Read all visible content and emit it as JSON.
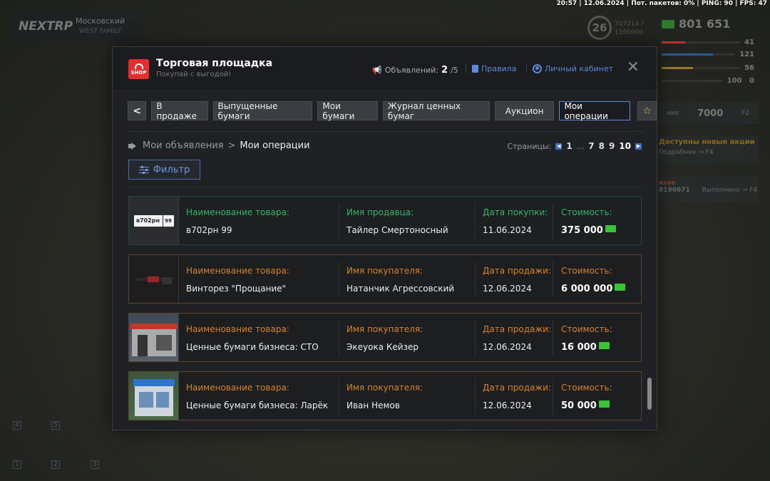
{
  "status_bar": "20:57 | 12.06.2024 | Пот. пакетов: 0% | PING: 90 | FPS: 47",
  "hud": {
    "logo": "NEXTRP",
    "server_name": "Московский",
    "server_sub": "WEST FAMILY",
    "level": "26",
    "exp_current": "707214 /",
    "exp_total": "1160000",
    "money": "801 651",
    "stats": [
      "41",
      "121",
      "56"
    ],
    "stats2": [
      "100",
      "0"
    ],
    "side_money": "7000",
    "side_label": "ние",
    "key_f2": "F2",
    "promo_title": "Доступны новые акции",
    "promo_more": "Подробнее →",
    "key_f4": "F4",
    "task_prefix": "изов",
    "task_id": "8196671",
    "task_status": "Выполнено →",
    "key_f4b": "F4",
    "slots": [
      "4",
      "5",
      "1",
      "2",
      "3"
    ]
  },
  "modal": {
    "shop_label": "SHOP",
    "title": "Торговая площадка",
    "subtitle": "Покупай с выгодой!",
    "ads_label": "Объявлений:",
    "ads_count": "2",
    "ads_limit": "/5",
    "rules_label": "Правила",
    "account_label": "Личный кабинет",
    "close": "✕"
  },
  "tabs": {
    "back": "<",
    "items": [
      "В продаже",
      "Выпущенные бумаги",
      "Мои бумаги",
      "Журнал ценных бумаг",
      "Аукцион",
      "Мои операции"
    ],
    "star": "☆"
  },
  "breadcrumb": {
    "parent": "Мои объявления",
    "sep": ">",
    "current": "Мои операции"
  },
  "pagination": {
    "label": "Страницы:",
    "prev": "◀",
    "next": "▶",
    "pages": [
      "1",
      "...",
      "7",
      "8",
      "9",
      "10"
    ],
    "active": "10"
  },
  "filter_label": "Фильтр",
  "operations": [
    {
      "type": "buy",
      "thumb_plate": "в702рн",
      "thumb_region": "99",
      "name_label": "Наименование товара:",
      "name": "в702рн 99",
      "party_label": "Имя продавца:",
      "party": "Тайлер Смертоносный",
      "date_label": "Дата покупки:",
      "date": "11.06.2024",
      "price_label": "Стоимость:",
      "price": "375 000"
    },
    {
      "type": "sell",
      "name_label": "Наименование товара:",
      "name": "Винторез \"Прощание\"",
      "party_label": "Имя покупателя:",
      "party": "Натанчик Агрессовский",
      "date_label": "Дата продажи:",
      "date": "12.06.2024",
      "price_label": "Стоимость:",
      "price": "6 000 000"
    },
    {
      "type": "sell",
      "name_label": "Наименование товара:",
      "name": "Ценные бумаги бизнеса: СТО",
      "party_label": "Имя покупателя:",
      "party": "Экеуока Кейзер",
      "date_label": "Дата продажи:",
      "date": "12.06.2024",
      "price_label": "Стоимость:",
      "price": "16 000"
    },
    {
      "type": "sell",
      "name_label": "Наименование товара:",
      "name": "Ценные бумаги бизнеса: Ларёк",
      "party_label": "Имя покупателя:",
      "party": "Иван Немов",
      "date_label": "Дата продажи:",
      "date": "12.06.2024",
      "price_label": "Стоимость:",
      "price": "50 000"
    }
  ],
  "colors": {
    "accent_blue": "#5b8ad6",
    "sell_label": "#d9822b",
    "buy_label": "#35b46b",
    "shop_red": "#e62d2d",
    "star": "#e8c33a"
  }
}
